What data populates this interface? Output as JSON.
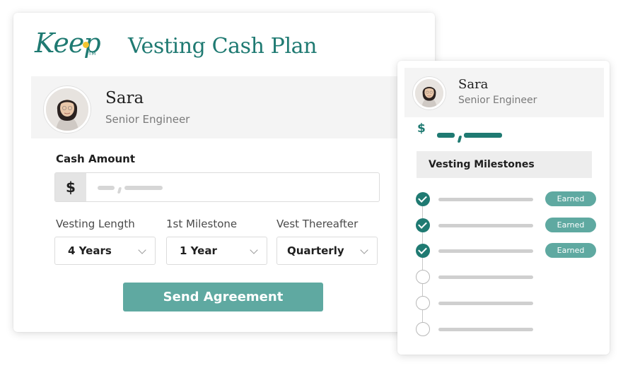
{
  "brand": {
    "logo_text": "Keep",
    "logo_tm": "TM",
    "accent": "#1f7a72",
    "button_color": "#5fa9a1",
    "logo_dot": "#f4c430"
  },
  "plan": {
    "title": "Vesting Cash Plan"
  },
  "employee": {
    "name": "Sara",
    "role": "Senior Engineer"
  },
  "form": {
    "cash_label": "Cash Amount",
    "currency_symbol": "$",
    "vesting_length": {
      "label": "Vesting Length",
      "value": "4 Years"
    },
    "first_milestone": {
      "label": "1st Milestone",
      "value": "1 Year"
    },
    "vest_thereafter": {
      "label": "Vest Thereafter",
      "value": "Quarterly"
    },
    "send_label": "Send Agreement"
  },
  "side_panel": {
    "currency_symbol": "$",
    "milestones_title": "Vesting Milestones",
    "milestones": [
      {
        "status": "earned",
        "badge": "Earned"
      },
      {
        "status": "earned",
        "badge": "Earned"
      },
      {
        "status": "earned",
        "badge": "Earned"
      },
      {
        "status": "pending",
        "badge": ""
      },
      {
        "status": "pending",
        "badge": ""
      },
      {
        "status": "pending",
        "badge": ""
      }
    ]
  }
}
